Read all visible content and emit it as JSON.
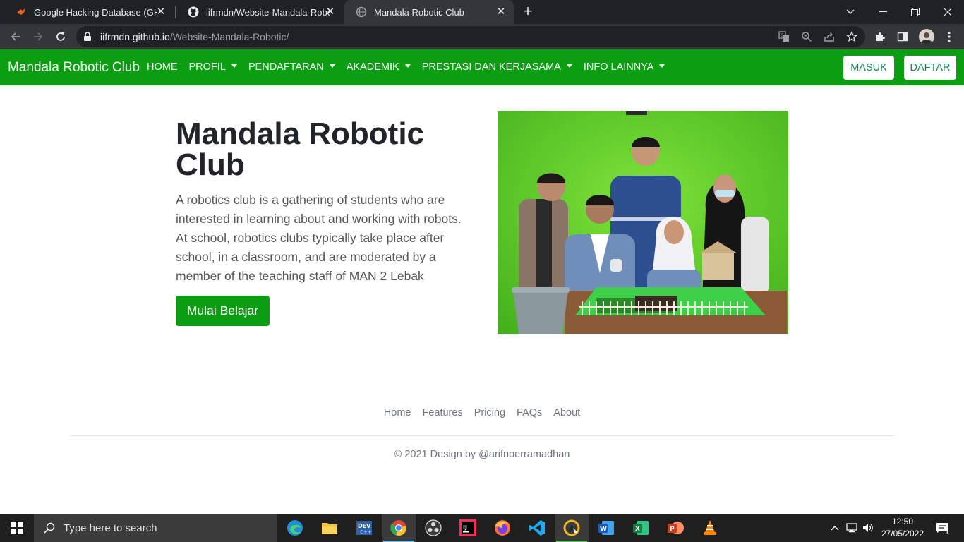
{
  "browser": {
    "tabs": [
      {
        "title": "Google Hacking Database (GHDB)",
        "active": false
      },
      {
        "title": "iifrmdn/Website-Mandala-Robotic",
        "active": false
      },
      {
        "title": "Mandala Robotic Club",
        "active": true
      }
    ],
    "url_host": "iifrmdn.github.io",
    "url_path": "/Website-Mandala-Robotic/"
  },
  "navbar": {
    "brand": "Mandala Robotic Club",
    "links": [
      {
        "label": "HOME",
        "dropdown": false
      },
      {
        "label": "PROFIL",
        "dropdown": true
      },
      {
        "label": "PENDAFTARAN",
        "dropdown": true
      },
      {
        "label": "AKADEMIK",
        "dropdown": true
      },
      {
        "label": "PRESTASI DAN KERJASAMA",
        "dropdown": true
      },
      {
        "label": "INFO LAINNYA",
        "dropdown": true
      }
    ],
    "login_label": "MASUK",
    "register_label": "DAFTAR"
  },
  "hero": {
    "title": "Mandala Robotic Club",
    "text": "A robotics club is a gathering of students who are interested in learning about and working with robots. At school, robotics clubs typically take place after school, in a classroom, and are moderated by a member of the teaching staff of MAN 2 Lebak",
    "cta_label": "Mulai Belajar"
  },
  "footer": {
    "links": [
      "Home",
      "Features",
      "Pricing",
      "FAQs",
      "About"
    ],
    "copyright": "© 2021 Design by @arifnoerramadhan"
  },
  "taskbar": {
    "search_placeholder": "Type here to search",
    "time": "12:50",
    "date": "27/05/2022",
    "notification_count": "1"
  },
  "colors": {
    "brand_green": "#0b9e12",
    "chrome_dark": "#202124",
    "chrome_toolbar": "#35363a"
  }
}
